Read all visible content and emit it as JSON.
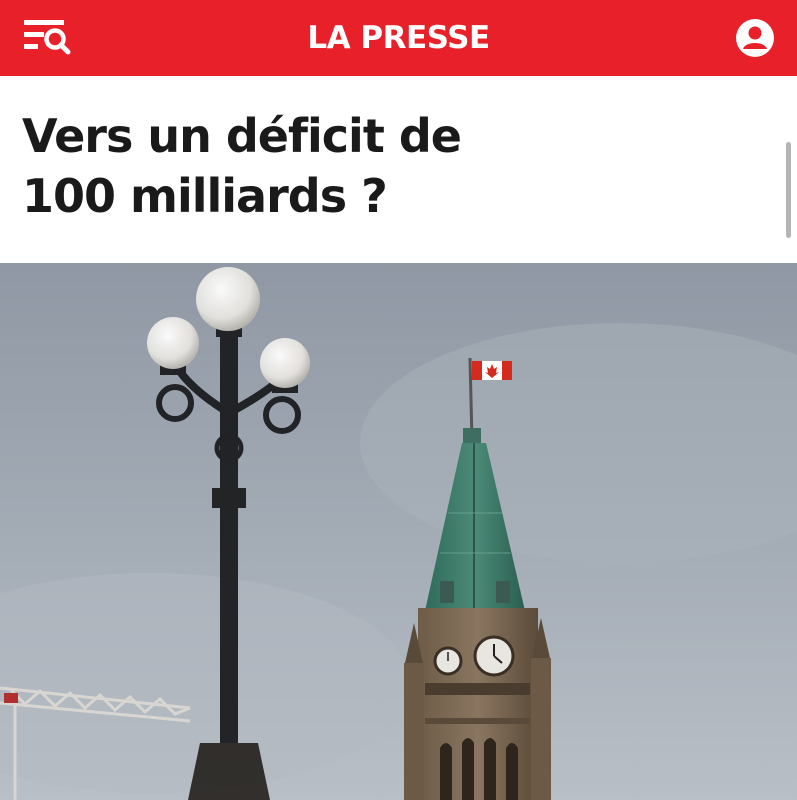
{
  "header": {
    "brand": "LA PRESSE",
    "menu_icon": "menu-search-icon",
    "account_icon": "account-icon",
    "color": "#e8202a"
  },
  "article": {
    "title_line1": "Vers un déficit de",
    "title_line2": "100 milliards ?"
  },
  "hero_image": {
    "subject": "Peace Tower with Canadian flag and street lamp",
    "sky_color": "#9aa2ad",
    "roof_color": "#3d7a68"
  }
}
